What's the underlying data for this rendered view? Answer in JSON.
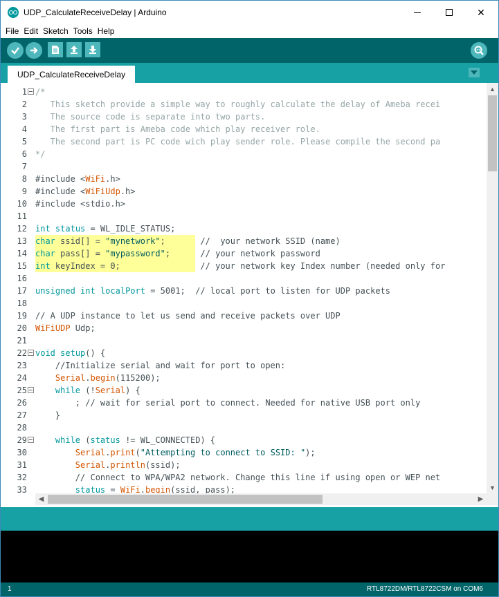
{
  "window": {
    "title": "UDP_CalculateReceiveDelay | Arduino",
    "controls": {
      "minimize": "—",
      "maximize": "☐",
      "close": "✕"
    }
  },
  "menu": [
    "File",
    "Edit",
    "Sketch",
    "Tools",
    "Help"
  ],
  "toolbar": {
    "buttons": [
      "verify-icon",
      "upload-icon",
      "new-icon",
      "open-icon",
      "save-icon"
    ],
    "right": "serial-monitor-icon"
  },
  "tabs": [
    {
      "label": "UDP_CalculateReceiveDelay"
    }
  ],
  "colors": {
    "toolbar": "#006468",
    "tabstrip": "#17a1a5",
    "button": "#4db7bb",
    "highlight": "#ffff99",
    "keyword": "#00979c",
    "function": "#d35400",
    "comment": "#95a5a6"
  },
  "code": {
    "lines": [
      {
        "n": "1",
        "fold": true,
        "segs": [
          [
            "c",
            "/*"
          ]
        ]
      },
      {
        "n": "2",
        "segs": [
          [
            "c",
            "   This sketch provide a simple way to roughly calculate the delay of Ameba recei"
          ]
        ]
      },
      {
        "n": "3",
        "segs": [
          [
            "c",
            "   The source code is separate into two parts."
          ]
        ]
      },
      {
        "n": "4",
        "segs": [
          [
            "c",
            "   The first part is Ameba code which play receiver role."
          ]
        ]
      },
      {
        "n": "5",
        "segs": [
          [
            "c",
            "   The second part is PC code wich play sender role. Please compile the second pa"
          ]
        ]
      },
      {
        "n": "6",
        "segs": [
          [
            "c",
            "*/"
          ]
        ]
      },
      {
        "n": "7",
        "segs": []
      },
      {
        "n": "8",
        "segs": [
          [
            "t",
            "#include <"
          ],
          [
            "f",
            "WiFi"
          ],
          [
            "t",
            ".h>"
          ]
        ]
      },
      {
        "n": "9",
        "segs": [
          [
            "t",
            "#include <"
          ],
          [
            "f",
            "WiFiUdp"
          ],
          [
            "t",
            ".h>"
          ]
        ]
      },
      {
        "n": "10",
        "segs": [
          [
            "t",
            "#include <stdio.h>"
          ]
        ]
      },
      {
        "n": "11",
        "segs": []
      },
      {
        "n": "12",
        "segs": [
          [
            "k",
            "int"
          ],
          [
            "t",
            " "
          ],
          [
            "k",
            "status"
          ],
          [
            "t",
            " = WL_IDLE_STATUS;"
          ]
        ]
      },
      {
        "n": "13",
        "hl": true,
        "segs": [
          [
            "k",
            "char"
          ],
          [
            "t",
            " ssid[] = "
          ],
          [
            "s",
            "\"mynetwork\""
          ],
          [
            "t",
            ";       //  your network SSID (name)"
          ]
        ]
      },
      {
        "n": "14",
        "hl": true,
        "segs": [
          [
            "k",
            "char"
          ],
          [
            "t",
            " pass[] = "
          ],
          [
            "s",
            "\"mypassword\""
          ],
          [
            "t",
            ";      // your network password"
          ]
        ]
      },
      {
        "n": "15",
        "hl": true,
        "segs": [
          [
            "k",
            "int"
          ],
          [
            "t",
            " keyIndex = 0;                // your network key Index number (needed only for"
          ]
        ]
      },
      {
        "n": "16",
        "segs": []
      },
      {
        "n": "17",
        "segs": [
          [
            "k",
            "unsigned"
          ],
          [
            "t",
            " "
          ],
          [
            "k",
            "int"
          ],
          [
            "t",
            " "
          ],
          [
            "k",
            "localPort"
          ],
          [
            "t",
            " = 5001;  // local port to listen for UDP packets"
          ]
        ]
      },
      {
        "n": "18",
        "segs": []
      },
      {
        "n": "19",
        "segs": [
          [
            "t",
            "// A UDP instance to let us send and receive packets over UDP"
          ]
        ]
      },
      {
        "n": "20",
        "segs": [
          [
            "f",
            "WiFiUDP"
          ],
          [
            "t",
            " Udp;"
          ]
        ]
      },
      {
        "n": "21",
        "segs": []
      },
      {
        "n": "22",
        "fold": true,
        "segs": [
          [
            "k",
            "void"
          ],
          [
            "t",
            " "
          ],
          [
            "k",
            "setup"
          ],
          [
            "t",
            "() {"
          ]
        ]
      },
      {
        "n": "23",
        "segs": [
          [
            "t",
            "    //Initialize serial and wait for port to open:"
          ]
        ]
      },
      {
        "n": "24",
        "segs": [
          [
            "t",
            "    "
          ],
          [
            "f",
            "Serial"
          ],
          [
            "t",
            "."
          ],
          [
            "f",
            "begin"
          ],
          [
            "t",
            "(115200);"
          ]
        ]
      },
      {
        "n": "25",
        "fold": true,
        "segs": [
          [
            "t",
            "    "
          ],
          [
            "k",
            "while"
          ],
          [
            "t",
            " (!"
          ],
          [
            "f",
            "Serial"
          ],
          [
            "t",
            ") {"
          ]
        ]
      },
      {
        "n": "26",
        "segs": [
          [
            "t",
            "        ; // wait for serial port to connect. Needed for native USB port only"
          ]
        ]
      },
      {
        "n": "27",
        "segs": [
          [
            "t",
            "    }"
          ]
        ]
      },
      {
        "n": "28",
        "segs": []
      },
      {
        "n": "29",
        "fold": true,
        "segs": [
          [
            "t",
            "    "
          ],
          [
            "k",
            "while"
          ],
          [
            "t",
            " ("
          ],
          [
            "k",
            "status"
          ],
          [
            "t",
            " != WL_CONNECTED) {"
          ]
        ]
      },
      {
        "n": "30",
        "segs": [
          [
            "t",
            "        "
          ],
          [
            "f",
            "Serial"
          ],
          [
            "t",
            "."
          ],
          [
            "f",
            "print"
          ],
          [
            "t",
            "("
          ],
          [
            "s",
            "\"Attempting to connect to SSID: \""
          ],
          [
            "t",
            ");"
          ]
        ]
      },
      {
        "n": "31",
        "segs": [
          [
            "t",
            "        "
          ],
          [
            "f",
            "Serial"
          ],
          [
            "t",
            "."
          ],
          [
            "f",
            "println"
          ],
          [
            "t",
            "(ssid);"
          ]
        ]
      },
      {
        "n": "32",
        "segs": [
          [
            "t",
            "        // Connect to WPA/WPA2 network. Change this line if using open or WEP net"
          ]
        ]
      },
      {
        "n": "33",
        "segs": [
          [
            "t",
            "        "
          ],
          [
            "k",
            "status"
          ],
          [
            "t",
            " = "
          ],
          [
            "f",
            "WiFi"
          ],
          [
            "t",
            "."
          ],
          [
            "f",
            "begin"
          ],
          [
            "t",
            "(ssid, pass);"
          ]
        ]
      }
    ]
  },
  "status": {
    "line": "1",
    "board": "RTL8722DM/RTL8722CSM on COM6"
  }
}
